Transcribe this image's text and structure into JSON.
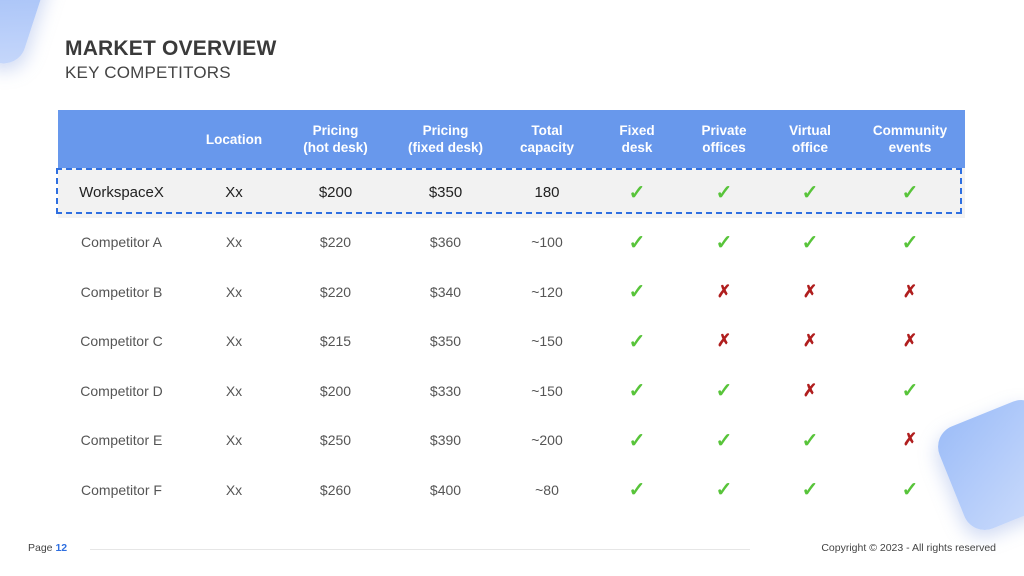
{
  "slide": {
    "title": "MARKET OVERVIEW",
    "subtitle": "KEY COMPETITORS"
  },
  "table": {
    "headers": [
      "",
      "Location",
      "Pricing\n(hot desk)",
      "Pricing\n(fixed desk)",
      "Total\ncapacity",
      "Fixed\ndesk",
      "Private\noffices",
      "Virtual\noffice",
      "Community\nevents"
    ],
    "rows": [
      {
        "name": "WorkspaceX",
        "location": "Xx",
        "hot_desk": "$200",
        "fixed_desk": "$350",
        "capacity": "180",
        "features": [
          true,
          true,
          true,
          true
        ],
        "highlight": true
      },
      {
        "name": "Competitor A",
        "location": "Xx",
        "hot_desk": "$220",
        "fixed_desk": "$360",
        "capacity": "~100",
        "features": [
          true,
          true,
          true,
          true
        ]
      },
      {
        "name": "Competitor B",
        "location": "Xx",
        "hot_desk": "$220",
        "fixed_desk": "$340",
        "capacity": "~120",
        "features": [
          true,
          false,
          false,
          false
        ]
      },
      {
        "name": "Competitor C",
        "location": "Xx",
        "hot_desk": "$215",
        "fixed_desk": "$350",
        "capacity": "~150",
        "features": [
          true,
          false,
          false,
          false
        ]
      },
      {
        "name": "Competitor D",
        "location": "Xx",
        "hot_desk": "$200",
        "fixed_desk": "$330",
        "capacity": "~150",
        "features": [
          true,
          true,
          false,
          true
        ]
      },
      {
        "name": "Competitor E",
        "location": "Xx",
        "hot_desk": "$250",
        "fixed_desk": "$390",
        "capacity": "~200",
        "features": [
          true,
          true,
          true,
          false
        ]
      },
      {
        "name": "Competitor F",
        "location": "Xx",
        "hot_desk": "$260",
        "fixed_desk": "$400",
        "capacity": "~80",
        "features": [
          true,
          true,
          true,
          true
        ]
      }
    ],
    "symbols": {
      "yes": "✓",
      "no": "✗"
    }
  },
  "footer": {
    "page_label": "Page",
    "page_number": "12",
    "copyright": "Copyright © 2023 - All rights reserved"
  },
  "colors": {
    "header_bg": "#6898ec",
    "highlight_border": "#2f6fe0",
    "check": "#58c43a",
    "cross": "#b01e1e"
  }
}
